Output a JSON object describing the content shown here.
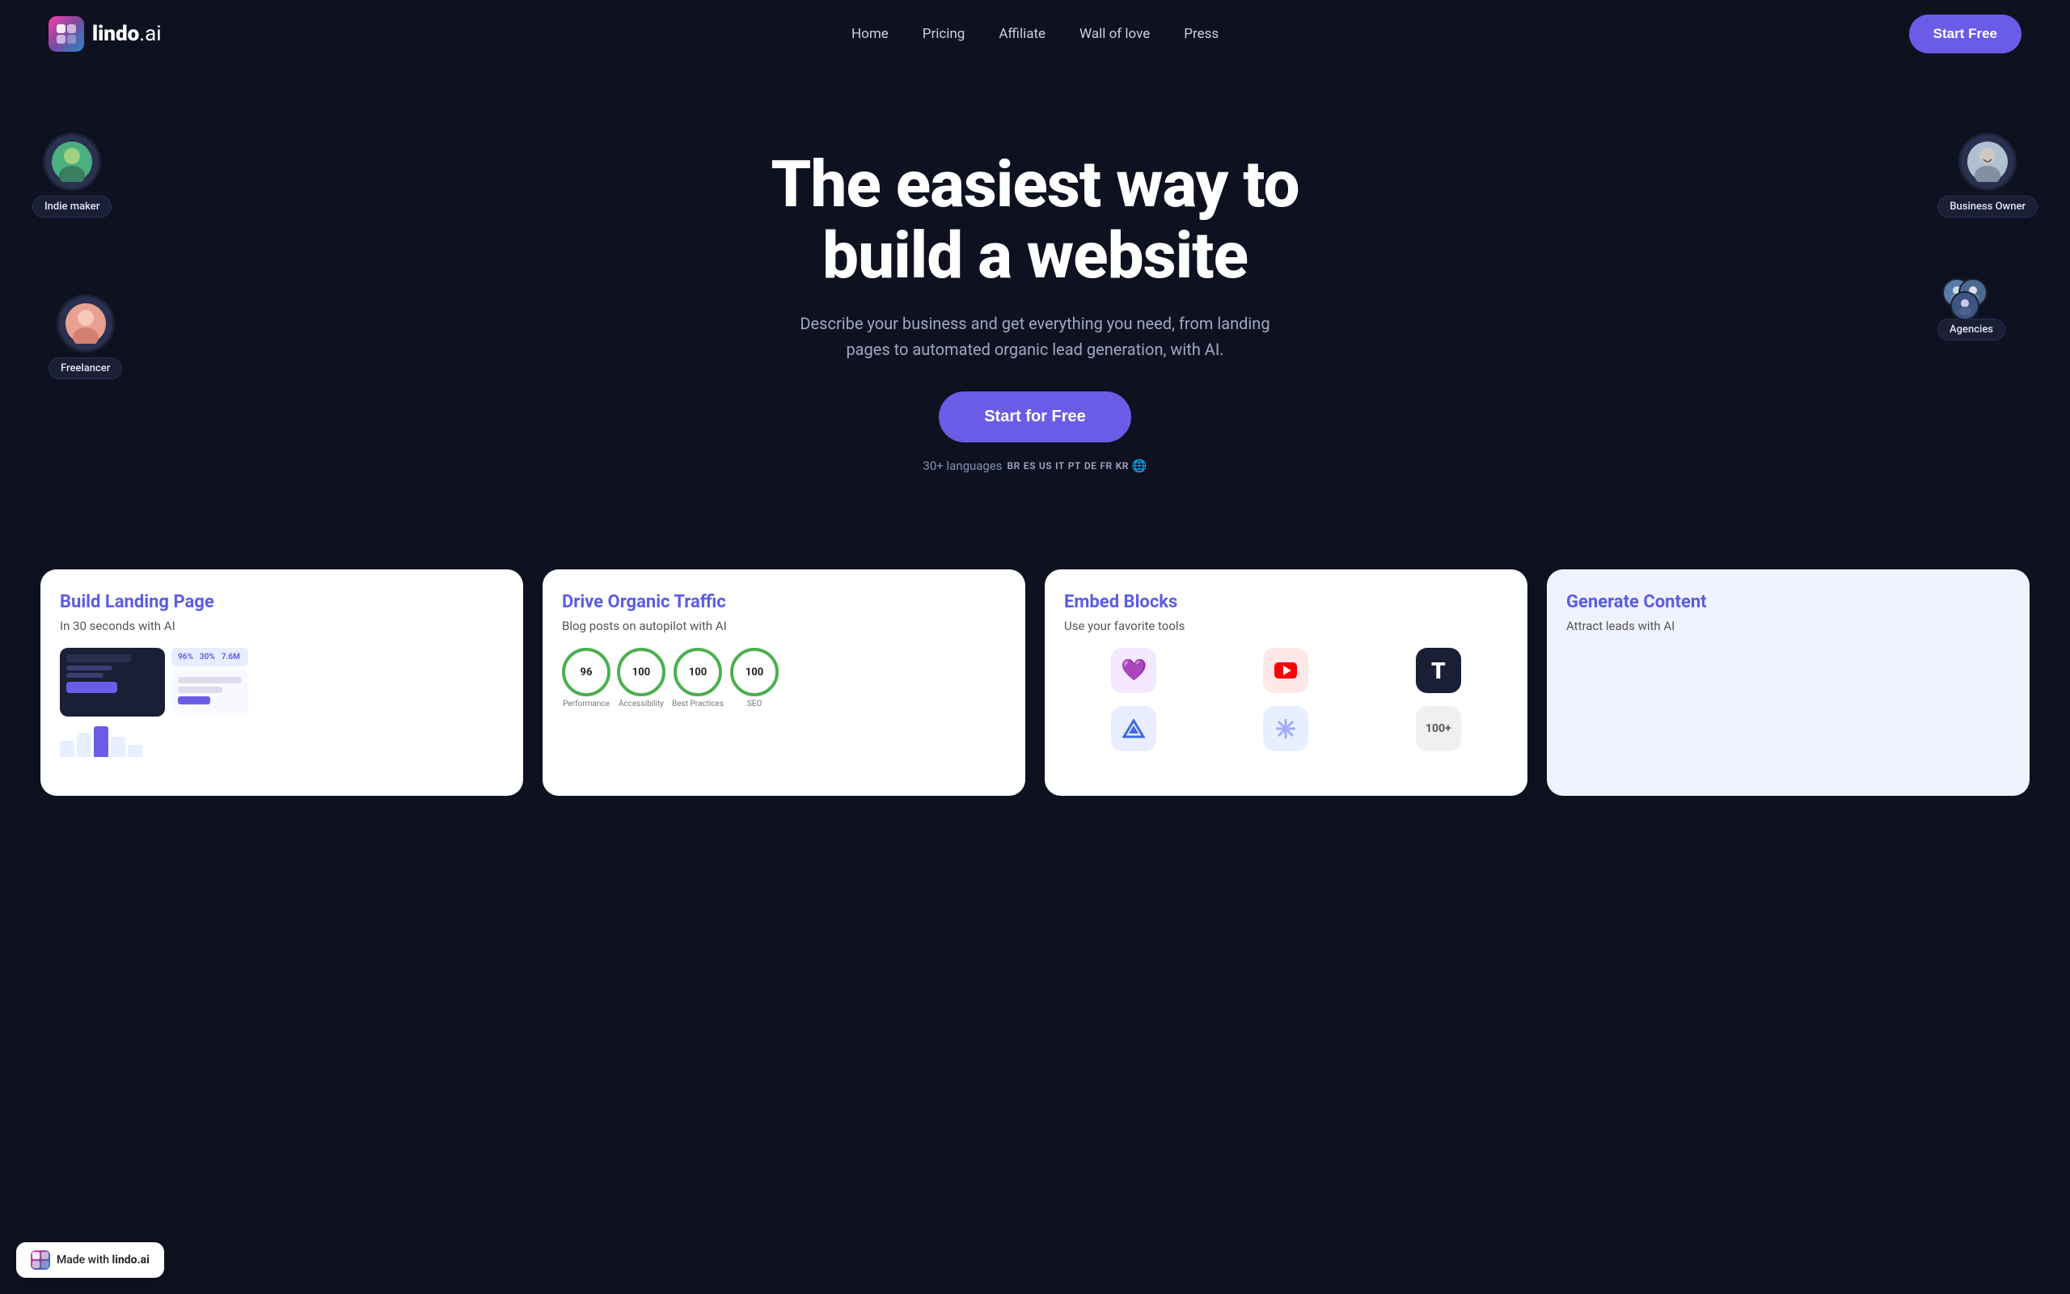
{
  "nav": {
    "logo_text": "lindo",
    "logo_suffix": ".ai",
    "links": [
      {
        "id": "home",
        "label": "Home"
      },
      {
        "id": "pricing",
        "label": "Pricing"
      },
      {
        "id": "affiliate",
        "label": "Affiliate"
      },
      {
        "id": "wall-of-love",
        "label": "Wall of love"
      },
      {
        "id": "press",
        "label": "Press"
      }
    ],
    "cta_label": "Start Free"
  },
  "hero": {
    "title": "The easiest way to build a website",
    "subtitle": "Describe your business and get everything you need, from landing pages to automated organic lead generation, with AI.",
    "cta_label": "Start for Free",
    "languages_prefix": "30+ languages",
    "language_tags": [
      "BR",
      "ES",
      "US",
      "IT",
      "PT",
      "DE",
      "FR",
      "KR"
    ],
    "globe_icon": "🌐"
  },
  "floating_users": [
    {
      "id": "indie-maker",
      "label": "Indie maker",
      "position": "top-left",
      "emoji": "👨"
    },
    {
      "id": "freelancer",
      "label": "Freelancer",
      "position": "mid-left",
      "emoji": "👩"
    },
    {
      "id": "business-owner",
      "label": "Business Owner",
      "position": "top-right",
      "emoji": "👨‍💼"
    },
    {
      "id": "agencies",
      "label": "Agencies",
      "position": "mid-right",
      "emoji": "👥"
    }
  ],
  "features": [
    {
      "id": "landing-page",
      "title": "Build Landing Page",
      "subtitle": "In 30 seconds with AI",
      "icon": "🖥️"
    },
    {
      "id": "organic-traffic",
      "title": "Drive Organic Traffic",
      "subtitle": "Blog posts on autopilot with AI",
      "scores": [
        {
          "value": "96",
          "label": "Performance"
        },
        {
          "value": "100",
          "label": "Accessibility"
        },
        {
          "value": "100",
          "label": "Best Practices"
        },
        {
          "value": "100",
          "label": "SEO"
        }
      ]
    },
    {
      "id": "embed-blocks",
      "title": "Embed Blocks",
      "subtitle": "Use your favorite tools",
      "extra_count": "100+"
    },
    {
      "id": "generate-content",
      "title": "Generate Content",
      "subtitle": "Attract leads with AI"
    }
  ],
  "made_with": {
    "prefix": "Made with",
    "brand": "lindo.ai"
  }
}
